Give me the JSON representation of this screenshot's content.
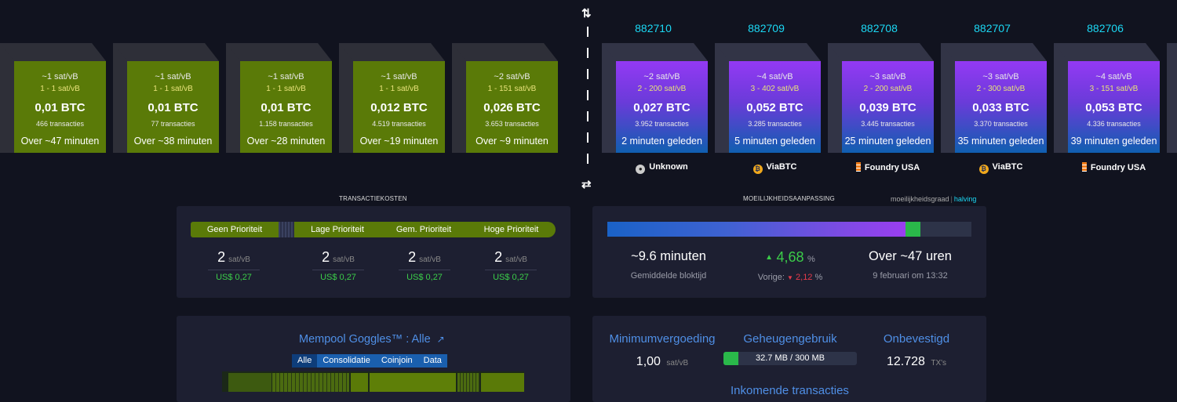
{
  "mempool_blocks": [
    {
      "fee": "~1 sat/vB",
      "range": "1 - 1 sat/vB",
      "btc": "0,01 BTC",
      "tx": "466 transacties",
      "eta": "Over ~47 minuten"
    },
    {
      "fee": "~1 sat/vB",
      "range": "1 - 1 sat/vB",
      "btc": "0,01 BTC",
      "tx": "77 transacties",
      "eta": "Over ~38 minuten"
    },
    {
      "fee": "~1 sat/vB",
      "range": "1 - 1 sat/vB",
      "btc": "0,01 BTC",
      "tx": "1.158 transacties",
      "eta": "Over ~28 minuten"
    },
    {
      "fee": "~1 sat/vB",
      "range": "1 - 1 sat/vB",
      "btc": "0,012 BTC",
      "tx": "4.519 transacties",
      "eta": "Over ~19 minuten"
    },
    {
      "fee": "~2 sat/vB",
      "range": "1 - 151 sat/vB",
      "btc": "0,026 BTC",
      "tx": "3.653 transacties",
      "eta": "Over ~9 minuten"
    }
  ],
  "divider": {
    "top_icon": "⇅",
    "bottom_icon": "⇄"
  },
  "confirmed_blocks": [
    {
      "height": "882710",
      "fee": "~2 sat/vB",
      "range": "2 - 200 sat/vB",
      "btc": "0,027 BTC",
      "tx": "3.952 transacties",
      "age": "2 minuten geleden",
      "pool": "Unknown",
      "pool_icon": "unknown-miner-icon"
    },
    {
      "height": "882709",
      "fee": "~4 sat/vB",
      "range": "3 - 402 sat/vB",
      "btc": "0,052 BTC",
      "tx": "3.285 transacties",
      "age": "5 minuten geleden",
      "pool": "ViaBTC",
      "pool_icon": "viabtc-icon"
    },
    {
      "height": "882708",
      "fee": "~3 sat/vB",
      "range": "2 - 200 sat/vB",
      "btc": "0,039 BTC",
      "tx": "3.445 transacties",
      "age": "25 minuten geleden",
      "pool": "Foundry USA",
      "pool_icon": "foundry-icon"
    },
    {
      "height": "882707",
      "fee": "~3 sat/vB",
      "range": "2 - 300 sat/vB",
      "btc": "0,033 BTC",
      "tx": "3.370 transacties",
      "age": "35 minuten geleden",
      "pool": "ViaBTC",
      "pool_icon": "viabtc-icon"
    },
    {
      "height": "882706",
      "fee": "~4 sat/vB",
      "range": "3 - 151 sat/vB",
      "btc": "0,053 BTC",
      "tx": "4.336 transacties",
      "age": "39 minuten geleden",
      "pool": "Foundry USA",
      "pool_icon": "foundry-icon"
    }
  ],
  "fees": {
    "title": "TRANSACTIEKOSTEN",
    "labels": [
      "Geen Prioriteit",
      "Lage Prioriteit",
      "Gem. Prioriteit",
      "Hoge Prioriteit"
    ],
    "values": [
      {
        "value": "2",
        "unit": "sat/vB",
        "usd": "US$ 0,27"
      },
      {
        "value": "2",
        "unit": "sat/vB",
        "usd": "US$ 0,27"
      },
      {
        "value": "2",
        "unit": "sat/vB",
        "usd": "US$ 0,27"
      },
      {
        "value": "2",
        "unit": "sat/vB",
        "usd": "US$ 0,27"
      }
    ]
  },
  "difficulty": {
    "title": "MOEILIJKHEIDSAANPASSING",
    "link_difficulty": "moeilijkheidsgraad",
    "link_separator": "|",
    "link_halving": "halving",
    "progress_fraction": 0.82,
    "ahead_fraction": 0.04,
    "avg_block": "~9.6 minuten",
    "avg_block_label": "Gemiddelde bloktijd",
    "change": "4,68",
    "change_unit": "%",
    "previous_label": "Vorige:",
    "previous": "2,12",
    "previous_unit": "%",
    "eta": "Over ~47 uren",
    "eta_date": "9 februari om 13:32"
  },
  "goggles": {
    "title": "Mempool Goggles™ : Alle",
    "tabs": [
      "Alle",
      "Consolidatie",
      "Coinjoin",
      "Data"
    ],
    "active_tab": "Alle"
  },
  "stats": {
    "min_fee_label": "Minimumvergoeding",
    "min_fee_value": "1,00",
    "min_fee_unit": "sat/vB",
    "memory_label": "Geheugengebruik",
    "memory_value": "32.7 MB / 300 MB",
    "memory_fraction": 0.11,
    "unconfirmed_label": "Onbevestigd",
    "unconfirmed_value": "12.728",
    "unconfirmed_unit": "TX's",
    "incoming_label": "Inkomende transacties"
  },
  "colors": {
    "background": "#11131f",
    "panel": "#1d1f31",
    "mempool_block": "#5a7a08",
    "accent_blue": "#1bd8f4",
    "green": "#3bcc49",
    "red": "#e53b4b"
  }
}
